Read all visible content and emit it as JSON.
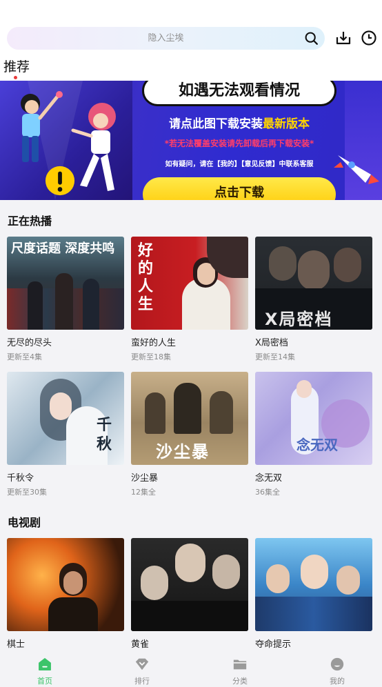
{
  "search": {
    "placeholder": "隐入尘埃"
  },
  "tabs": {
    "recommend": "推荐"
  },
  "banner": {
    "headline": "如遇无法观看情况",
    "line1_a": "请点此图下载安装",
    "line1_b": "最新版本",
    "line2": "*若无法覆盖安装请先卸载后再下载安装*",
    "line3": "如有疑问，请在【我的】【意见反馈】中联系客服",
    "button": "点击下载"
  },
  "sections": {
    "hot": {
      "title": "正在热播",
      "items": [
        {
          "name": "无尽的尽头",
          "status": "更新至4集",
          "poster_text": "尺度话题 深度共鸣"
        },
        {
          "name": "蛮好的人生",
          "status": "更新至18集",
          "poster_text": "好的人生"
        },
        {
          "name": "X局密档",
          "status": "更新至14集",
          "poster_text": "X局密档"
        },
        {
          "name": "千秋令",
          "status": "更新至30集",
          "poster_text": "千秋"
        },
        {
          "name": "沙尘暴",
          "status": "12集全",
          "poster_text": "沙尘暴"
        },
        {
          "name": "念无双",
          "status": "36集全",
          "poster_text": "念无双"
        }
      ]
    },
    "tv": {
      "title": "电视剧",
      "items": [
        {
          "name": "棋士",
          "status": ""
        },
        {
          "name": "黄雀",
          "status": ""
        },
        {
          "name": "夺命提示",
          "status": ""
        }
      ]
    }
  },
  "nav": {
    "home": "首页",
    "rank": "排行",
    "category": "分类",
    "mine": "我的"
  },
  "colors": {
    "accent": "#3cc46a",
    "badge_dot": "#e93a3a"
  }
}
